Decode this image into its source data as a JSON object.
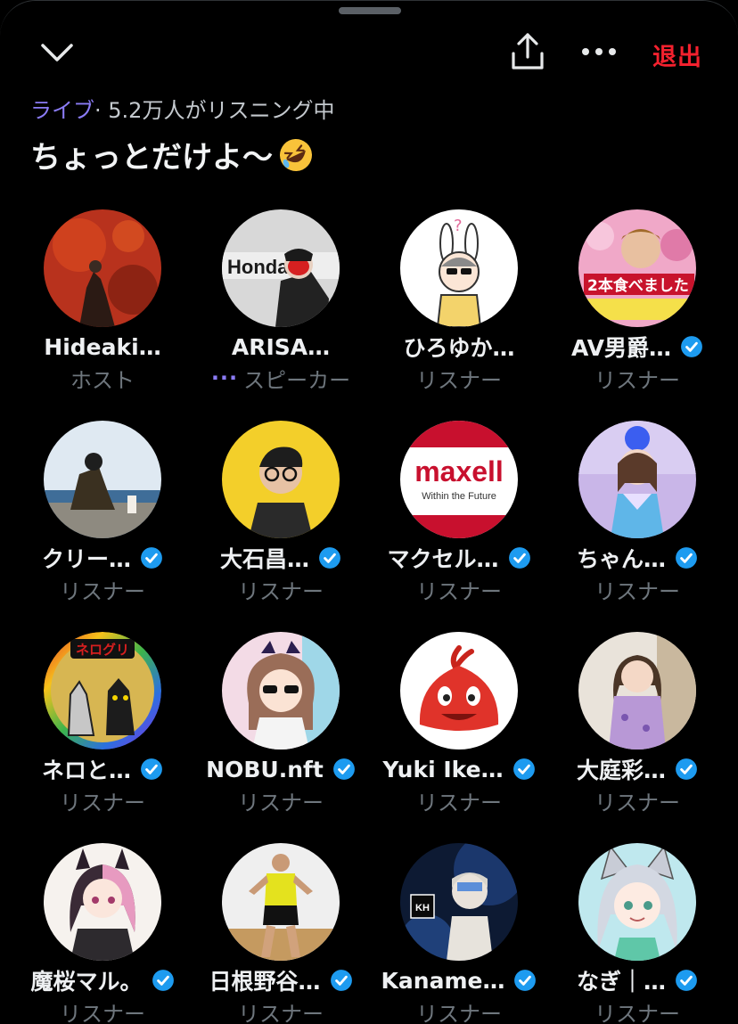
{
  "header": {
    "exit_label": "退出"
  },
  "status": {
    "live_label": "ライブ",
    "separator": "·",
    "listeners_text": "5.2万人がリスニング中"
  },
  "space": {
    "title": "ちょっとだけよ〜"
  },
  "colors": {
    "accent_purple": "#8b7cf6",
    "exit_red": "#f4212e",
    "verified_blue": "#1d9bf0"
  },
  "participants": [
    {
      "name": "Hideaki…",
      "role": "ホスト",
      "verified": false
    },
    {
      "name": "ARISA…",
      "role": "スピーカー",
      "verified": false,
      "speaking": true
    },
    {
      "name": "ひろゆか…",
      "role": "リスナー",
      "verified": false
    },
    {
      "name": "AV男爵…",
      "role": "リスナー",
      "verified": true
    },
    {
      "name": "クリー…",
      "role": "リスナー",
      "verified": true
    },
    {
      "name": "大石昌…",
      "role": "リスナー",
      "verified": true
    },
    {
      "name": "マクセル…",
      "role": "リスナー",
      "verified": true
    },
    {
      "name": "ちゃん…",
      "role": "リスナー",
      "verified": true
    },
    {
      "name": "ネロと…",
      "role": "リスナー",
      "verified": true
    },
    {
      "name": "NOBU.nft",
      "role": "リスナー",
      "verified": true
    },
    {
      "name": "Yuki Ike…",
      "role": "リスナー",
      "verified": true
    },
    {
      "name": "大庭彩…",
      "role": "リスナー",
      "verified": true
    },
    {
      "name": "魔桜マル。",
      "role": "リスナー",
      "verified": true
    },
    {
      "name": "日根野谷…",
      "role": "リスナー",
      "verified": true
    },
    {
      "name": "Kaname…",
      "role": "リスナー",
      "verified": true
    },
    {
      "name": "なぎ｜…",
      "role": "リスナー",
      "verified": true
    }
  ],
  "avatar_texts": {
    "honda": "Honda",
    "maxell_brand": "maxell",
    "maxell_tagline": "Within the Future",
    "nero_banner": "ネログリ",
    "tv_caption": "2本食べました",
    "kh_logo": "KH"
  }
}
